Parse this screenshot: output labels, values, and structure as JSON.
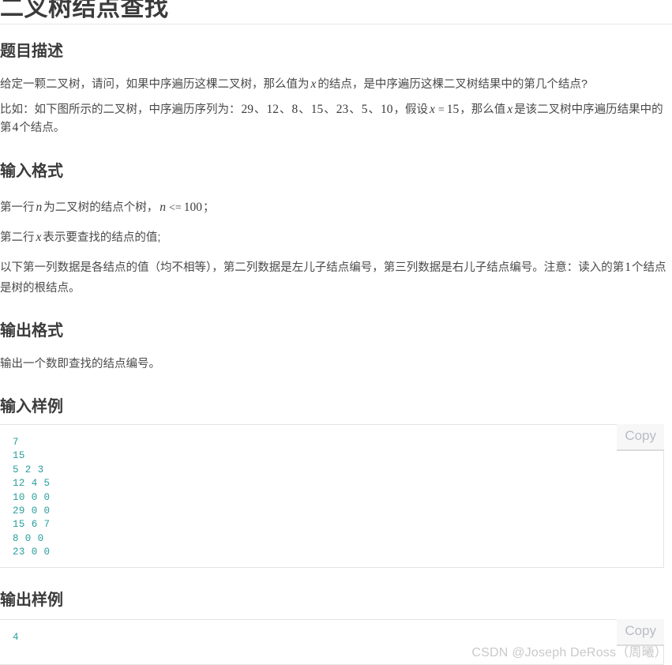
{
  "page": {
    "title": "二叉树结点查找",
    "watermark": "CSDN @Joseph DeRoss（周曦）"
  },
  "sections": {
    "description": {
      "heading": "题目描述",
      "p1_a": "给定一颗二叉树，请问，如果中序遍历这棵二叉树，那么值为",
      "p1_x": "x",
      "p1_b": "的结点，是中序遍历这棵二叉树结果中的第几个结点?",
      "p2_a": "比如：如下图所示的二叉树，中序遍历序列为：",
      "p2_seq": [
        "29",
        "12",
        "8",
        "15",
        "23",
        "5",
        "10"
      ],
      "p2_sep": "、",
      "p2_b": "，假设",
      "p2_x": "x",
      "p2_eq": "=",
      "p2_val": "15",
      "p2_c": "，那么值",
      "p2_x2": "x",
      "p2_d": "是该二叉树中序遍历结果中的第",
      "p2_num": "4",
      "p2_e": "个结点。"
    },
    "input_format": {
      "heading": "输入格式",
      "l1_a": "第一行",
      "l1_n": "n",
      "l1_b": "为二叉树的结点个树，",
      "l1_n2": "n",
      "l1_op": "<=",
      "l1_limit": "100",
      "l1_c": "；",
      "l2_a": "第二行",
      "l2_x": "x",
      "l2_b": "表示要查找的结点的值;",
      "l3_a": "以下第一列数据是各结点的值（均不相等），第二列数据是左儿子结点编号，第三列数据是右儿子结点编号。注意：读入的第",
      "l3_num": "1",
      "l3_b": "个结点是树的根结点。"
    },
    "output_format": {
      "heading": "输出格式",
      "text": "输出一个数即查找的结点编号。"
    },
    "input_sample": {
      "heading": "输入样例",
      "copy_label": "Copy",
      "code": "7\n15\n5 2 3\n12 4 5\n10 0 0\n29 0 0\n15 6 7\n8 0 0\n23 0 0"
    },
    "output_sample": {
      "heading": "输出样例",
      "copy_label": "Copy",
      "code": "4"
    }
  },
  "colors": {
    "code_text": "#2a9d9d",
    "heading": "#3b3b3b",
    "body_text": "#4a4a4a",
    "border": "#e3e3e3",
    "watermark": "#c9c9c9"
  }
}
